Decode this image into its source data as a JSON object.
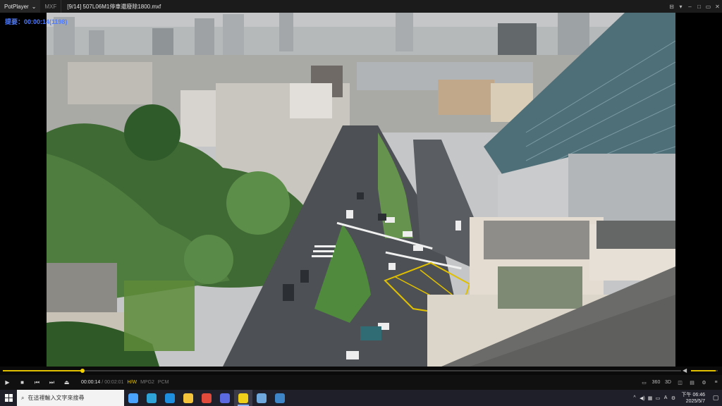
{
  "titlebar": {
    "app_name": "PotPlayer",
    "format_label": "MXF",
    "file_title": "[9/14] 507L06M1停車還廢除1800.mxf"
  },
  "osd": {
    "text": "提要：00:00:14(1198)"
  },
  "playback": {
    "progress": 0.117,
    "volume": 0.92,
    "current_time": "00:00:14",
    "separator": "/",
    "total_time": "00:02:01",
    "badge_hw": "H/W",
    "badge_video": "MPG2",
    "badge_audio": "PCM"
  },
  "control_icons": [
    "play-icon",
    "stop-icon",
    "previous-icon",
    "next-icon",
    "eject-icon"
  ],
  "right_controls": [
    "3D",
    "360",
    "3D",
    "CC",
    "SET",
    "MENU"
  ],
  "taskbar": {
    "search_placeholder": "在這裡輸入文字來搜尋",
    "apps": [
      {
        "name": "weather",
        "color": "#4aa3ff"
      },
      {
        "name": "edge",
        "color": "#2ea3d8"
      },
      {
        "name": "ie",
        "color": "#1e8fe0"
      },
      {
        "name": "explorer",
        "color": "#f2c33b"
      },
      {
        "name": "chrome",
        "color": "#e04a3a"
      },
      {
        "name": "potplayer-blue",
        "color": "#5b6ae0"
      },
      {
        "name": "potplayer",
        "color": "#f0cf1a"
      },
      {
        "name": "app-blue",
        "color": "#6fa8dc"
      },
      {
        "name": "docs",
        "color": "#3d85c6"
      }
    ],
    "clock_period_time": "下午 06:46",
    "clock_date": "2025/5/7"
  }
}
